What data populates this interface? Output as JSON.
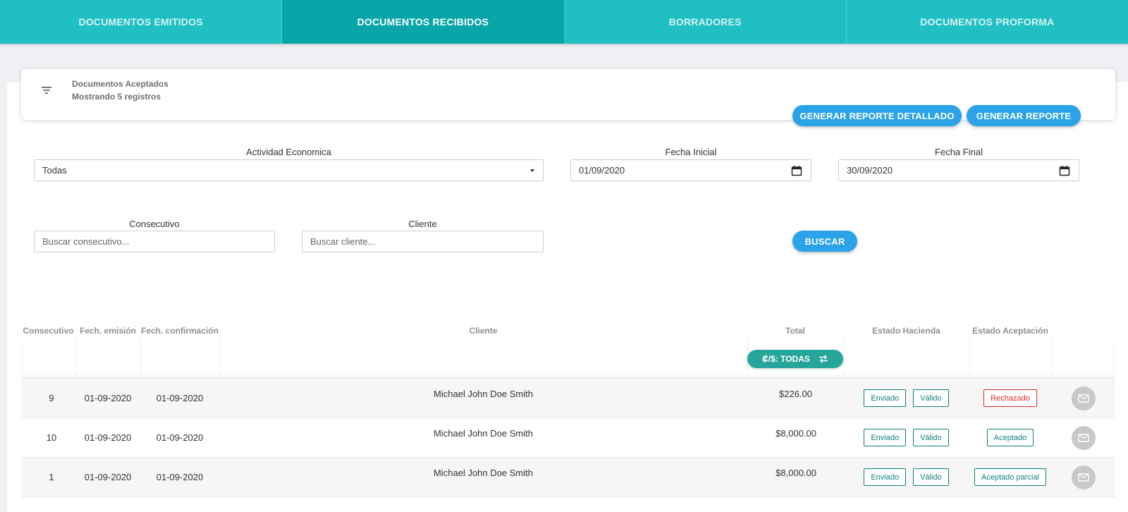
{
  "tabs": [
    {
      "label": "DOCUMENTOS EMITIDOS",
      "active": false
    },
    {
      "label": "DOCUMENTOS RECIBIDOS",
      "active": true
    },
    {
      "label": "BORRADORES",
      "active": false
    },
    {
      "label": "DOCUMENTOS PROFORMA",
      "active": false
    }
  ],
  "summary": {
    "title": "Documentos Aceptados",
    "count_text": "Mostrando 5 registros",
    "icon": "filter-icon"
  },
  "actions": {
    "detailed_report": "GENERAR REPORTE DETALLADO",
    "report": "GENERAR REPORTE",
    "search": "BUSCAR"
  },
  "filters": {
    "activity_label": "Actividad Economica",
    "activity_value": "Todas",
    "start_label": "Fecha Inicial",
    "start_value": "01/09/2020",
    "end_label": "Fecha Final",
    "end_value": "30/09/2020",
    "consecutive_label": "Consecutivo",
    "consecutive_placeholder": "Buscar consecutivo...",
    "client_label": "Cliente",
    "client_placeholder": "Buscar cliente..."
  },
  "table": {
    "headers": [
      "Consecutivo",
      "Fech. emisión",
      "Fech. confirmación",
      "Cliente",
      "Total",
      "Estado Hacienda",
      "Estado Aceptación"
    ],
    "currency_toggle": "₡/$: TODAS",
    "rows": [
      {
        "consecutivo": "9",
        "emision": "01-09-2020",
        "confirmacion": "01-09-2020",
        "cliente": "Michael John Doe Smith",
        "total": "$226.00",
        "hacienda_1": "Enviado",
        "hacienda_2": "Válido",
        "aceptacion": "Rechazado",
        "aceptacion_color": "#e02a2a"
      },
      {
        "consecutivo": "10",
        "emision": "01-09-2020",
        "confirmacion": "01-09-2020",
        "cliente": "Michael John Doe Smith",
        "total": "$8,000.00",
        "hacienda_1": "Enviado",
        "hacienda_2": "Válido",
        "aceptacion": "Aceptado",
        "aceptacion_color": "#0f7f7f"
      },
      {
        "consecutivo": "1",
        "emision": "01-09-2020",
        "confirmacion": "01-09-2020",
        "cliente": "Michael John Doe Smith",
        "total": "$8,000.00",
        "hacienda_1": "Enviado",
        "hacienda_2": "Válido",
        "aceptacion": "Aceptado parcial",
        "aceptacion_color": "#0f7f7f"
      }
    ]
  },
  "colors": {
    "tab_bar": "#1fbfc4",
    "tab_active": "#08a6a9",
    "primary_button": "#2aa3e8",
    "badge_teal": "#0f7f7f",
    "badge_red": "#e02a2a",
    "currency_pill": "#26a69a"
  }
}
